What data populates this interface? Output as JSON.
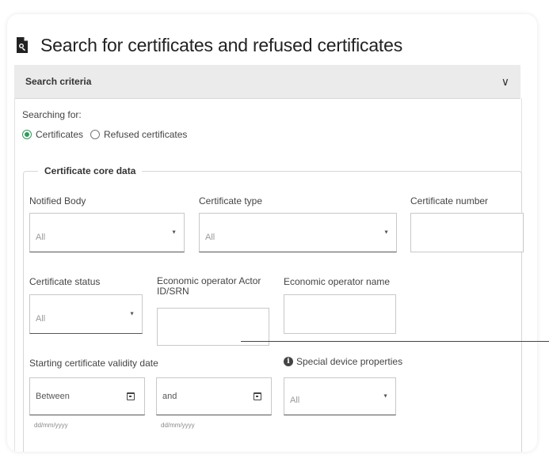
{
  "page": {
    "title": "Search for certificates and refused certificates",
    "title_icon": "document-search-icon"
  },
  "accordion": {
    "label": "Search criteria",
    "chevron": "∨"
  },
  "searching_for": {
    "label": "Searching for:",
    "options": [
      {
        "label": "Certificates",
        "selected": true
      },
      {
        "label": "Refused certificates",
        "selected": false
      }
    ]
  },
  "core_data": {
    "legend": "Certificate core data",
    "notified_body": {
      "label": "Notified Body",
      "value": "All"
    },
    "certificate_type": {
      "label": "Certificate type",
      "value": "All"
    },
    "certificate_number": {
      "label": "Certificate number",
      "value": ""
    },
    "certificate_status": {
      "label": "Certificate status",
      "value": "All"
    },
    "eo_actor_id": {
      "label_line1": "Economic operator Actor",
      "label_line2": "ID/SRN",
      "value": ""
    },
    "eo_name": {
      "label": "Economic operator name",
      "value": ""
    },
    "validity_date": {
      "label": "Starting certificate validity date",
      "from_placeholder": "Between",
      "to_placeholder": "and",
      "format_hint": "dd/mm/yyyy"
    },
    "special_props": {
      "label": "Special device properties",
      "value": "All",
      "info_icon": "info-icon"
    }
  },
  "colors": {
    "accent": "#2e9c5a",
    "header_bg": "#ebebeb"
  }
}
